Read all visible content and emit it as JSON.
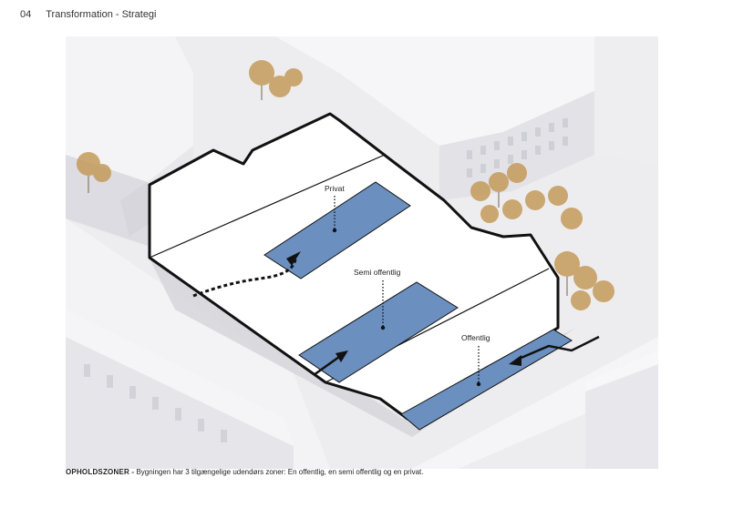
{
  "header": {
    "page_number": "04",
    "section_title": "Transformation - Strategi"
  },
  "diagram": {
    "zones": [
      {
        "label": "Privat",
        "level": "private"
      },
      {
        "label": "Semi offentlig",
        "level": "semi-public"
      },
      {
        "label": "Offentlig",
        "level": "public"
      }
    ]
  },
  "colors": {
    "zone_fill": "#6b8fbf",
    "outline": "#111111",
    "building_fill": "#ffffff",
    "context": "#e4e4e8",
    "tree": "#c49a5a"
  },
  "caption": {
    "title": "OPHOLDSZONER -",
    "text": " Bygningen har  3 tilgængelige udendørs zoner: En offentlig, en semi offentlig og en privat."
  }
}
